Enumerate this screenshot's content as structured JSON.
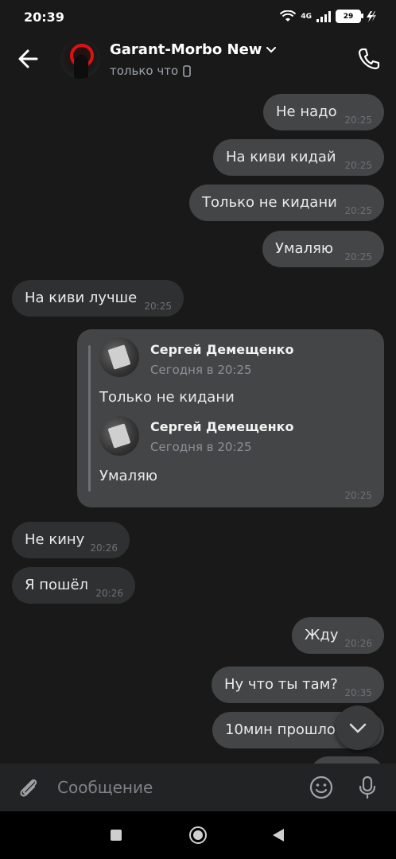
{
  "status_bar": {
    "time": "20:39",
    "network": "4G",
    "battery": "29"
  },
  "header": {
    "name": "Garant-Morbo New",
    "status": "только что"
  },
  "messages": {
    "m1": {
      "text": "Не надо",
      "time": "20:25"
    },
    "m2": {
      "text": "На киви кидай",
      "time": "20:25"
    },
    "m3": {
      "text": "Только не кидани",
      "time": "20:25"
    },
    "m4": {
      "text": "Умаляю",
      "time": "20:25"
    },
    "m5": {
      "text": "На киви лучше",
      "time": "20:25"
    },
    "forward": {
      "first": {
        "author": "Сергей Демещенко",
        "date": "Сегодня в 20:25",
        "text": "Только не кидани"
      },
      "second": {
        "author": "Сергей Демещенко",
        "date": "Сегодня в 20:25",
        "text": "Умаляю"
      },
      "time": "20:25"
    },
    "m6": {
      "text": "Не кину",
      "time": "20:26"
    },
    "m7": {
      "text": "Я пошёл",
      "time": "20:26"
    },
    "m8": {
      "text": "Жду",
      "time": "20:26"
    },
    "m9": {
      "text": "Ну что ты там?",
      "time": "20:35"
    },
    "m10": {
      "text": "10мин прошло",
      "time": ""
    }
  },
  "composer": {
    "placeholder": "Сообщение"
  },
  "icons": {
    "back": "arrow-left-icon",
    "call": "phone-icon",
    "attach": "paperclip-icon",
    "emoji": "smile-icon",
    "mic": "microphone-icon",
    "scroll": "chevron-down-icon"
  },
  "colors": {
    "background": "#19191a",
    "incoming_bubble": "#2f3031",
    "outgoing_bubble": "#444546",
    "composer": "#222324"
  }
}
